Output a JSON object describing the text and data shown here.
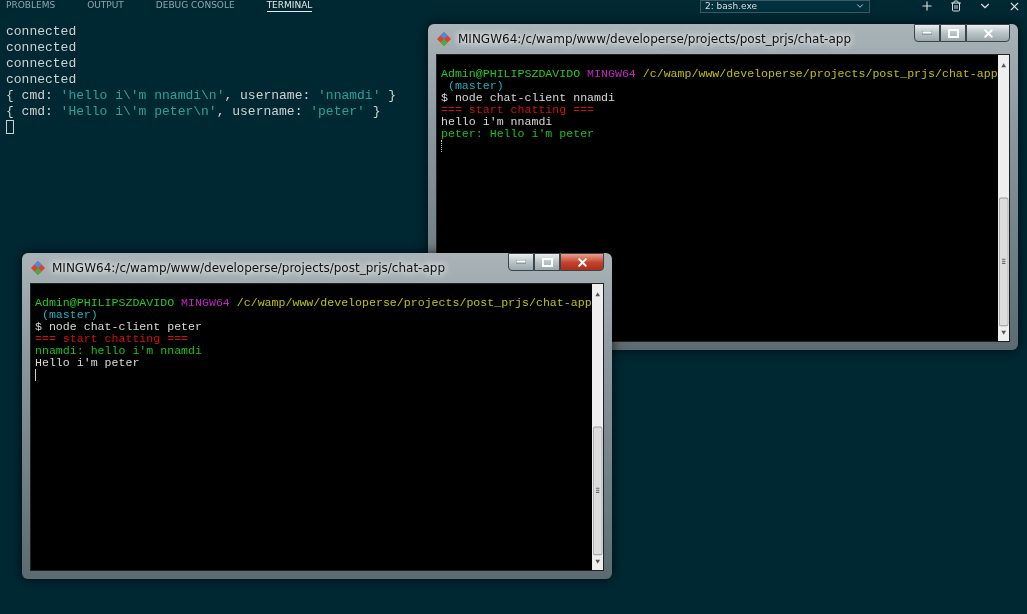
{
  "panel": {
    "tabs": [
      {
        "label": "PROBLEMS",
        "selected": false
      },
      {
        "label": "OUTPUT",
        "selected": false
      },
      {
        "label": "DEBUG CONSOLE",
        "selected": false
      },
      {
        "label": "TERMINAL",
        "selected": true
      }
    ],
    "terminal_select": "2: bash.exe"
  },
  "output": [
    {
      "segments": [
        {
          "text": "connected",
          "kind": "plain"
        }
      ]
    },
    {
      "segments": [
        {
          "text": "connected",
          "kind": "plain"
        }
      ]
    },
    {
      "segments": [
        {
          "text": "connected",
          "kind": "plain"
        }
      ]
    },
    {
      "segments": [
        {
          "text": "connected",
          "kind": "plain"
        }
      ]
    },
    {
      "segments": [
        {
          "text": "{ cmd: ",
          "kind": "plain"
        },
        {
          "text": "'hello i\\'m nnamdi\\n'",
          "kind": "string"
        },
        {
          "text": ", username: ",
          "kind": "plain"
        },
        {
          "text": "'nnamdi'",
          "kind": "string"
        },
        {
          "text": " }",
          "kind": "plain"
        }
      ]
    },
    {
      "segments": [
        {
          "text": "{ cmd: ",
          "kind": "plain"
        },
        {
          "text": "'Hello i\\'m peter\\n'",
          "kind": "string"
        },
        {
          "text": ", username: ",
          "kind": "plain"
        },
        {
          "text": "'peter'",
          "kind": "string"
        },
        {
          "text": " }",
          "kind": "plain"
        }
      ]
    }
  ],
  "windows": [
    {
      "title": "MINGW64:/c/wamp/www/developerse/projects/post_prjs/chat-app",
      "active": false,
      "lines": [
        {
          "segments": [
            {
              "text": "Admin@PHILIPSZDAVIDO",
              "kind": "user"
            },
            {
              "text": " MINGW64",
              "kind": "host"
            },
            {
              "text": " /c/wamp/www/developerse/projects/post_prjs/chat-app",
              "kind": "path"
            }
          ]
        },
        {
          "segments": [
            {
              "text": " (master)",
              "kind": "branch"
            }
          ]
        },
        {
          "segments": [
            {
              "text": "$ node chat-client nnamdi",
              "kind": "command"
            }
          ]
        },
        {
          "segments": [
            {
              "text": "=== start chatting ===",
              "kind": "banner"
            }
          ]
        },
        {
          "segments": [
            {
              "text": "hello i'm nnamdi",
              "kind": "command"
            }
          ]
        },
        {
          "segments": [
            {
              "text": "peter: Hello i'm peter",
              "kind": "peer"
            }
          ]
        }
      ]
    },
    {
      "title": "MINGW64:/c/wamp/www/developerse/projects/post_prjs/chat-app",
      "active": true,
      "lines": [
        {
          "segments": [
            {
              "text": "Admin@PHILIPSZDAVIDO",
              "kind": "user"
            },
            {
              "text": " MINGW64",
              "kind": "host"
            },
            {
              "text": " /c/wamp/www/developerse/projects/post_prjs/chat-app",
              "kind": "path"
            }
          ]
        },
        {
          "segments": [
            {
              "text": " (master)",
              "kind": "branch"
            }
          ]
        },
        {
          "segments": [
            {
              "text": "$ node chat-client peter",
              "kind": "command"
            }
          ]
        },
        {
          "segments": [
            {
              "text": "=== start chatting ===",
              "kind": "banner"
            }
          ]
        },
        {
          "segments": [
            {
              "text": "nnamdi: hello i'm nnamdi",
              "kind": "peer"
            }
          ]
        },
        {
          "segments": [
            {
              "text": "Hello i'm peter",
              "kind": "command"
            }
          ]
        }
      ]
    }
  ]
}
